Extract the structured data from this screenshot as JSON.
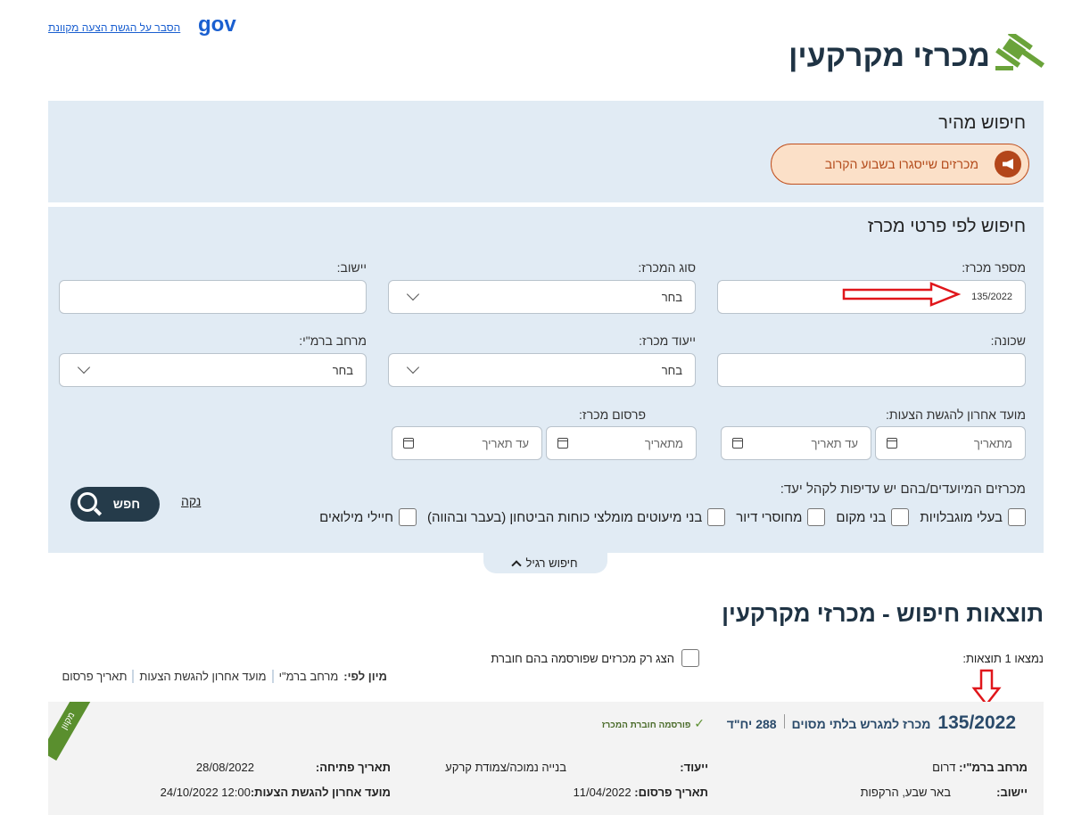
{
  "header": {
    "logo": "gov",
    "help_link": "הסבר על הגשת הצעה מקוונת",
    "title": "מכרזי מקרקעין",
    "title_icon": "gavel-icon"
  },
  "quick_search": {
    "title": "חיפוש מהיר",
    "button": "מכרזים שייסגרו בשבוע הקרוב",
    "button_icon": "megaphone-icon"
  },
  "search": {
    "title": "חיפוש לפי פרטי מכרז",
    "fields": {
      "tender_number": {
        "label": "מספר מכרז:",
        "value": "135/2022"
      },
      "tender_type": {
        "label": "סוג המכרז:",
        "value": "בחר"
      },
      "settlement": {
        "label": "יישוב:",
        "value": ""
      },
      "neighborhood": {
        "label": "שכונה:",
        "value": ""
      },
      "purpose": {
        "label": "ייעוד מכרז:",
        "value": "בחר"
      },
      "region": {
        "label": "מרחב ברמ\"י:",
        "value": "בחר"
      },
      "deadline": {
        "label": "מועד אחרון להגשת הצעות:",
        "from": "מתאריך",
        "to": "עד תאריך"
      },
      "publication": {
        "label": "פרסום מכרז:",
        "from": "מתאריך",
        "to": "עד תאריך"
      }
    },
    "audience_label": "מכרזים המיועדים/בהם יש עדיפות לקהל יעד:",
    "audiences": [
      "בעלי מוגבלויות",
      "בני מקום",
      "מחוסרי דיור",
      "בני מיעוטים מומלצי כוחות הביטחון (בעבר ובהווה)",
      "חיילי מילואים"
    ],
    "search_button": "חפש",
    "clear_link": "נקה",
    "toggle": "חיפוש רגיל"
  },
  "results": {
    "title": "תוצאות חיפוש - מכרזי מקרקעין",
    "count": "נמצאו 1 תוצאות:",
    "company_filter": "הצג רק מכרזים שפורסמה בהם חוברת",
    "sort_label": "מיון לפי:",
    "sort_options": [
      "מרחב ברמ\"י",
      "מועד אחרון להגשת הצעות",
      "תאריך פרסום"
    ],
    "items": [
      {
        "ribbon": "מקוון",
        "number": "135/2022",
        "description": "מכרז למגרש בלתי מסוים",
        "units": "288 יח\"ד",
        "booklet": "פורסמה חוברת המכרז",
        "region_label": "מרחב ברמ\"י:",
        "region": "דרום",
        "purpose_label": "ייעוד:",
        "purpose": "בנייה נמוכה/צמודת קרקע",
        "opening_label": "תאריך פתיחה:",
        "opening": "28/08/2022",
        "settlement_label": "יישוב:",
        "settlement": "באר שבע, הרקפות",
        "publication_label": "תאריך פרסום:",
        "publication": "11/04/2022",
        "deadline_label": "מועד אחרון להגשת הצעות:",
        "deadline": "24/10/2022 12:00"
      }
    ]
  },
  "colors": {
    "panel": "#e1ebf4",
    "accent_orange": "#c0501f",
    "dark": "#253b4a",
    "green": "#5a8f2e",
    "annotation_red": "#e0161b"
  }
}
